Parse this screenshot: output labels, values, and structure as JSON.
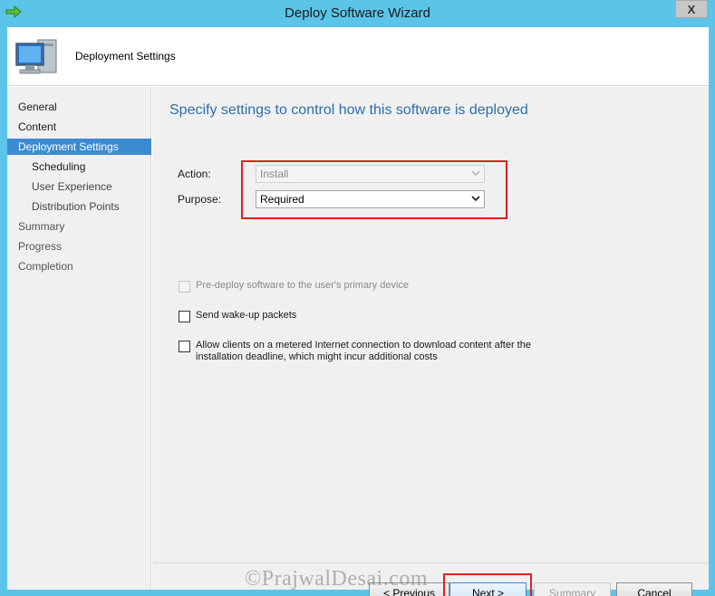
{
  "window": {
    "title": "Deploy Software Wizard",
    "close_label": "X"
  },
  "header": {
    "title": "Deployment Settings"
  },
  "sidebar": {
    "items": [
      {
        "label": "General"
      },
      {
        "label": "Content"
      },
      {
        "label": "Deployment Settings"
      },
      {
        "label": "Scheduling"
      },
      {
        "label": "User Experience"
      },
      {
        "label": "Distribution Points"
      },
      {
        "label": "Summary"
      },
      {
        "label": "Progress"
      },
      {
        "label": "Completion"
      }
    ],
    "selected": "Deployment Settings"
  },
  "main": {
    "heading": "Specify settings to control how this software is deployed",
    "action": {
      "label": "Action:",
      "value": "Install",
      "enabled": false
    },
    "purpose": {
      "label": "Purpose:",
      "value": "Required",
      "enabled": true
    },
    "checkboxes": [
      {
        "label": "Pre-deploy software to the user's primary device",
        "checked": false,
        "enabled": false
      },
      {
        "label": "Send wake-up packets",
        "checked": false,
        "enabled": true
      },
      {
        "label": "Allow clients on a metered Internet connection to download content after the installation deadline, which might incur additional costs",
        "checked": false,
        "enabled": true
      }
    ]
  },
  "footer": {
    "previous_label": "< Previous",
    "next_label": "Next >",
    "summary_label": "Summary",
    "cancel_label": "Cancel"
  },
  "watermark": "©PrajwalDesai.com",
  "colors": {
    "frame": "#5bc4e8",
    "selected": "#3c8bd1",
    "heading": "#2e6ea6",
    "highlight": "#e32020"
  }
}
